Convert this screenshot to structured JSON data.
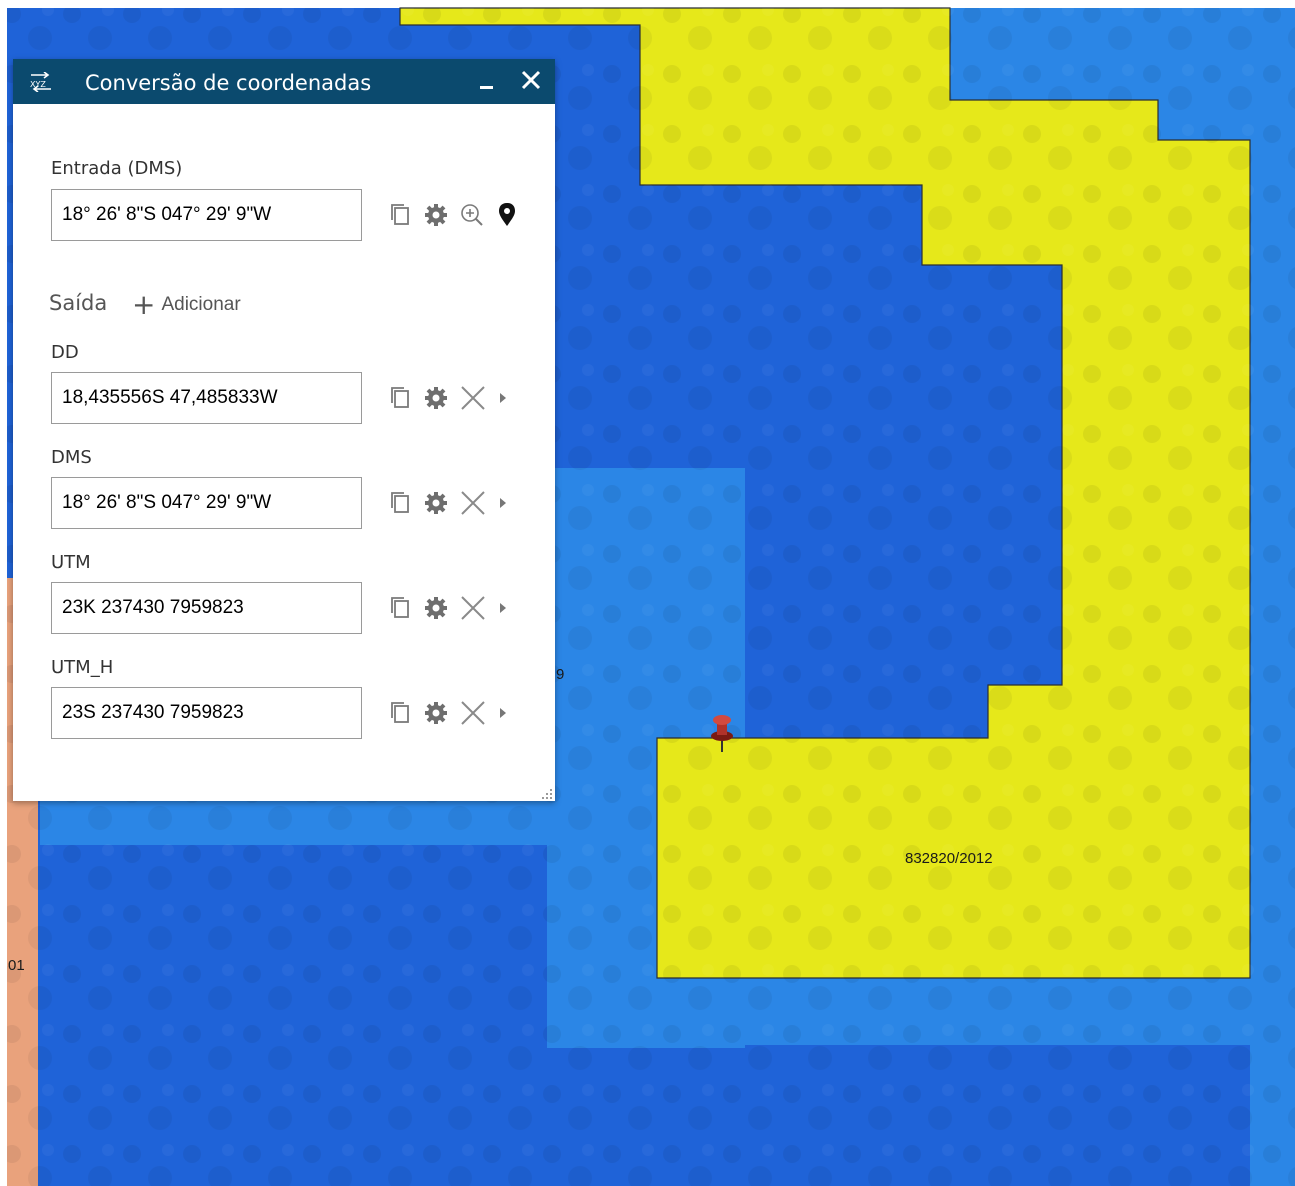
{
  "widget": {
    "title": "Conversão de coordenadas",
    "icon": "xyz-convert-icon",
    "header_color": "#0b4a6e",
    "input": {
      "label": "Entrada (DMS)",
      "value": "18° 26' 8\"S 047° 29' 9\"W",
      "tools": [
        "copy-icon",
        "gear-icon",
        "zoom-in-icon",
        "map-pin-icon"
      ]
    },
    "output": {
      "title": "Saída",
      "add_label": "Adicionar",
      "rows": [
        {
          "label": "DD",
          "value": "18,435556S 47,485833W"
        },
        {
          "label": "DMS",
          "value": "18° 26' 8\"S 047° 29' 9\"W"
        },
        {
          "label": "UTM",
          "value": "23K 237430 7959823"
        },
        {
          "label": "UTM_H",
          "value": "23S 237430 7959823"
        }
      ],
      "row_tools": [
        "copy-icon",
        "gear-icon",
        "remove-icon",
        "expand-arrow-icon"
      ]
    }
  },
  "map": {
    "labels": {
      "parcel": "832820/2012",
      "left_fragment": "01",
      "mid_fragment": "9"
    },
    "colors": {
      "blue": "#2b86e6",
      "dark_blue": "#1f63d8",
      "yellow": "#e6e81a",
      "salmon": "#e9a27c"
    }
  }
}
